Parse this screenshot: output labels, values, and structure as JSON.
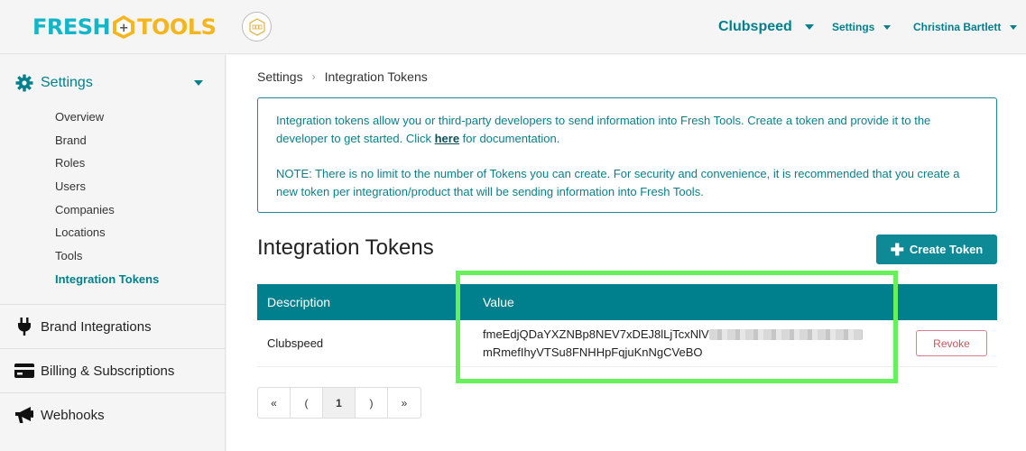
{
  "header": {
    "logo_left": "FRESH",
    "logo_right": "TOOLS",
    "logo_plus": "+",
    "company": "Clubspeed",
    "settings": "Settings",
    "user": "Christina Bartlett"
  },
  "sidebar": {
    "settings_label": "Settings",
    "items": [
      "Overview",
      "Brand",
      "Roles",
      "Users",
      "Companies",
      "Locations",
      "Tools",
      "Integration Tokens"
    ],
    "sections": [
      "Brand Integrations",
      "Billing & Subscriptions",
      "Webhooks"
    ]
  },
  "breadcrumb": {
    "root": "Settings",
    "current": "Integration Tokens"
  },
  "info": {
    "p1_before": "Integration tokens allow you or third-party developers to send information into Fresh Tools. Create a token and provide it to the developer to get started. Click ",
    "p1_link": "here",
    "p1_after": " for documentation.",
    "p2": "NOTE: There is no limit to the number of Tokens you can create. For security and convenience, it is recommended that you create a new token per integration/product that will be sending information into Fresh Tools."
  },
  "page_title": "Integration Tokens",
  "create_button": "Create Token",
  "table": {
    "headers": {
      "description": "Description",
      "value": "Value"
    },
    "rows": [
      {
        "description": "Clubspeed",
        "value_start": "fmeEdjQDaYXZNBp8NEV7xDEJ8lLjTcxNlV",
        "value_end": "mRmefIhyVTSu8FNHHpFqjuKnNgCVeBO",
        "action": "Revoke"
      }
    ]
  },
  "pagination": [
    "«",
    "(",
    "1",
    ")",
    "»"
  ],
  "colors": {
    "teal": "#00808c",
    "highlight": "#66f05a",
    "revoke": "#c7545e"
  }
}
